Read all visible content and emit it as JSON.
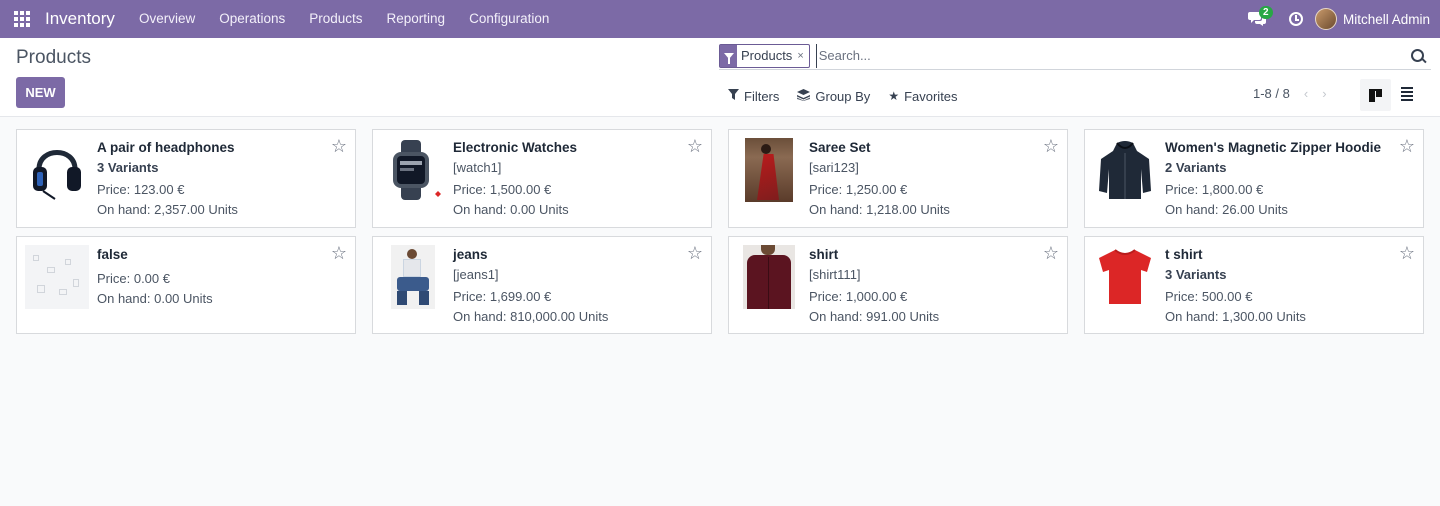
{
  "navbar": {
    "app_name": "Inventory",
    "menu": [
      "Overview",
      "Operations",
      "Products",
      "Reporting",
      "Configuration"
    ],
    "chat_count": "2",
    "user_name": "Mitchell Admin",
    "bg_color": "#7c6aa6"
  },
  "control_panel": {
    "title": "Products",
    "new_button": "NEW",
    "facet_label": "Products",
    "facet_remove": "×",
    "search_placeholder": "Search...",
    "filters": "Filters",
    "group_by": "Group By",
    "favorites": "Favorites",
    "pager": "1-8 / 8",
    "prev": "‹",
    "next": "›"
  },
  "products": [
    {
      "name": "A pair of headphones",
      "ref": "",
      "variants": "3 Variants",
      "price": "Price: 123.00 €",
      "on_hand": "On hand: 2,357.00 Units",
      "image": "headphones-image"
    },
    {
      "name": "Electronic Watches",
      "ref": "[watch1]",
      "variants": "",
      "price": "Price: 1,500.00 €",
      "on_hand": "On hand: 0.00 Units",
      "image": "smartwatch-image"
    },
    {
      "name": "Saree Set",
      "ref": "[sari123]",
      "variants": "",
      "price": "Price: 1,250.00 €",
      "on_hand": "On hand: 1,218.00 Units",
      "image": "saree-image"
    },
    {
      "name": "Women's Magnetic Zipper Hoodie",
      "ref": "",
      "variants": "2 Variants",
      "price": "Price: 1,800.00 €",
      "on_hand": "On hand: 26.00 Units",
      "image": "hoodie-image"
    },
    {
      "name": "false",
      "ref": "",
      "variants": "",
      "price": "Price: 0.00 €",
      "on_hand": "On hand: 0.00 Units",
      "image": "placeholder-image"
    },
    {
      "name": "jeans",
      "ref": "[jeans1]",
      "variants": "",
      "price": "Price: 1,699.00 €",
      "on_hand": "On hand: 810,000.00 Units",
      "image": "jeans-image"
    },
    {
      "name": "shirt",
      "ref": "[shirt111]",
      "variants": "",
      "price": "Price: 1,000.00 €",
      "on_hand": "On hand: 991.00 Units",
      "image": "shirt-image"
    },
    {
      "name": "t shirt",
      "ref": "",
      "variants": "3 Variants",
      "price": "Price: 500.00 €",
      "on_hand": "On hand: 1,300.00 Units",
      "image": "tshirt-image"
    }
  ]
}
